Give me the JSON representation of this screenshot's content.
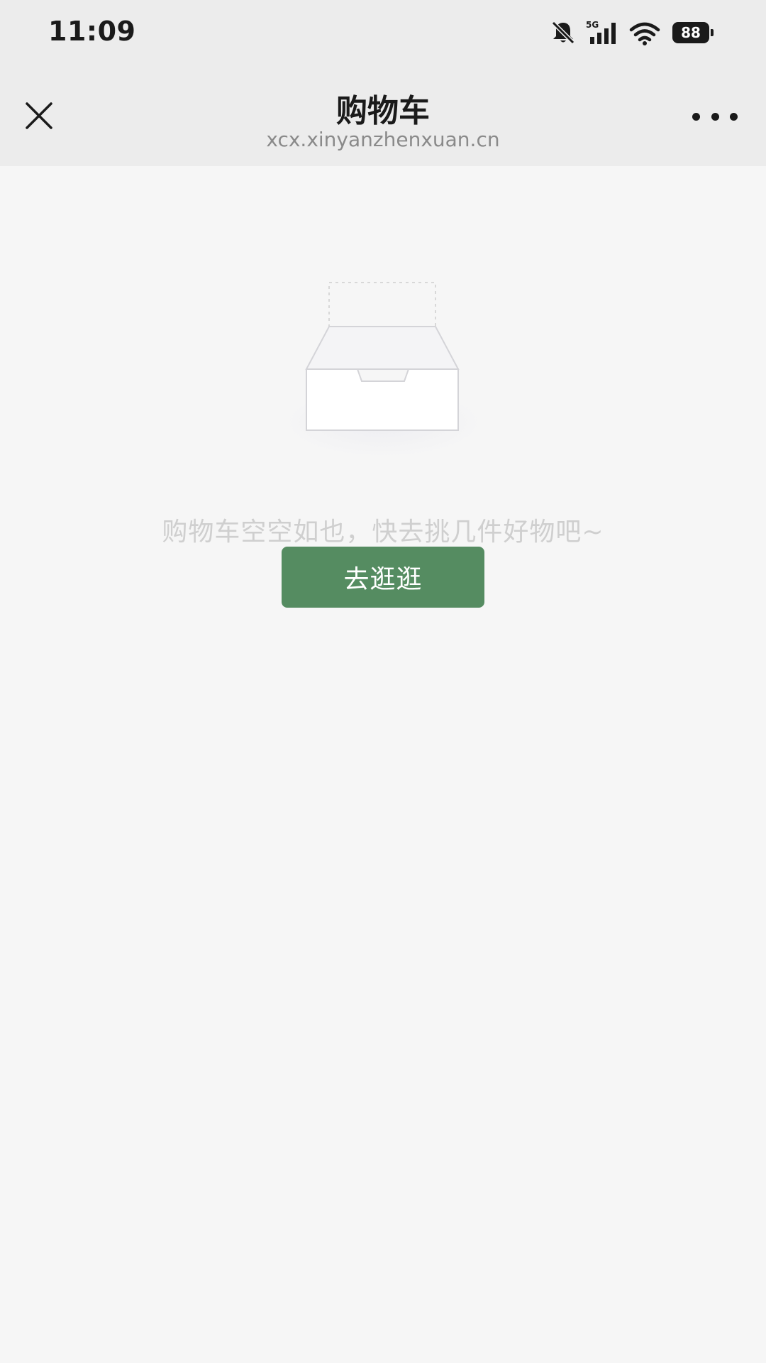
{
  "status_bar": {
    "time": "11:09",
    "network_label": "5G",
    "battery": "88",
    "icons": [
      "mute-bell-icon",
      "cellular-signal-icon",
      "wifi-icon",
      "battery-icon"
    ]
  },
  "nav": {
    "title": "购物车",
    "subtitle": "xcx.xinyanzhenxuan.cn",
    "close_icon": "close-icon",
    "more_icon": "more-icon"
  },
  "empty_state": {
    "illustration_icon": "empty-box-icon",
    "message": "购物车空空如也，快去挑几件好物吧~",
    "button_label": "去逛逛"
  },
  "colors": {
    "primary": "#558c61",
    "background": "#f6f6f6",
    "header_background": "#ececec",
    "muted_text": "#cfcfcf"
  }
}
